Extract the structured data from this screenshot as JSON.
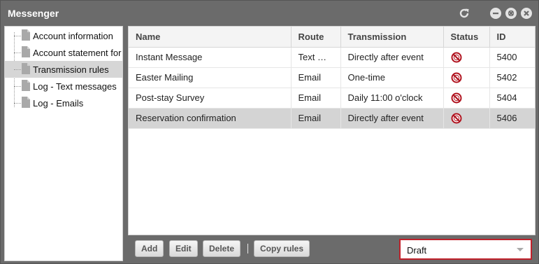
{
  "window": {
    "title": "Messenger"
  },
  "titlebar_icons": [
    "refresh-icon",
    "minimize-icon",
    "restore-icon",
    "close-icon"
  ],
  "sidebar": {
    "items": [
      {
        "label": "Account information",
        "icon": "document-icon",
        "selected": false
      },
      {
        "label": "Account statement for",
        "icon": "document-icon",
        "selected": false
      },
      {
        "label": "Transmission rules",
        "icon": "document-icon",
        "selected": true
      },
      {
        "label": "Log - Text messages",
        "icon": "document-icon",
        "selected": false
      },
      {
        "label": "Log - Emails",
        "icon": "document-icon",
        "selected": false
      }
    ]
  },
  "table": {
    "columns": [
      "Name",
      "Route",
      "Transmission",
      "Status",
      "ID"
    ],
    "rows": [
      {
        "name": "Instant Message",
        "route": "Text …",
        "transmission": "Directly after event",
        "status": "disabled-icon",
        "id": "5400",
        "selected": false
      },
      {
        "name": "Easter Mailing",
        "route": "Email",
        "transmission": "One-time",
        "status": "disabled-icon",
        "id": "5402",
        "selected": false
      },
      {
        "name": "Post-stay Survey",
        "route": "Email",
        "transmission": "Daily 11:00 o'clock",
        "status": "disabled-icon",
        "id": "5404",
        "selected": false
      },
      {
        "name": "Reservation confirmation",
        "route": "Email",
        "transmission": "Directly after event",
        "status": "disabled-icon",
        "id": "5406",
        "selected": true
      }
    ]
  },
  "toolbar": {
    "add_label": "Add",
    "edit_label": "Edit",
    "delete_label": "Delete",
    "copy_label": "Copy rules",
    "filter_value": "Draft"
  },
  "colors": {
    "accent": "#c0202a",
    "status_icon": "#b0121e",
    "titlebar": "#6b6b6b",
    "selected_row": "#d4d4d4"
  }
}
